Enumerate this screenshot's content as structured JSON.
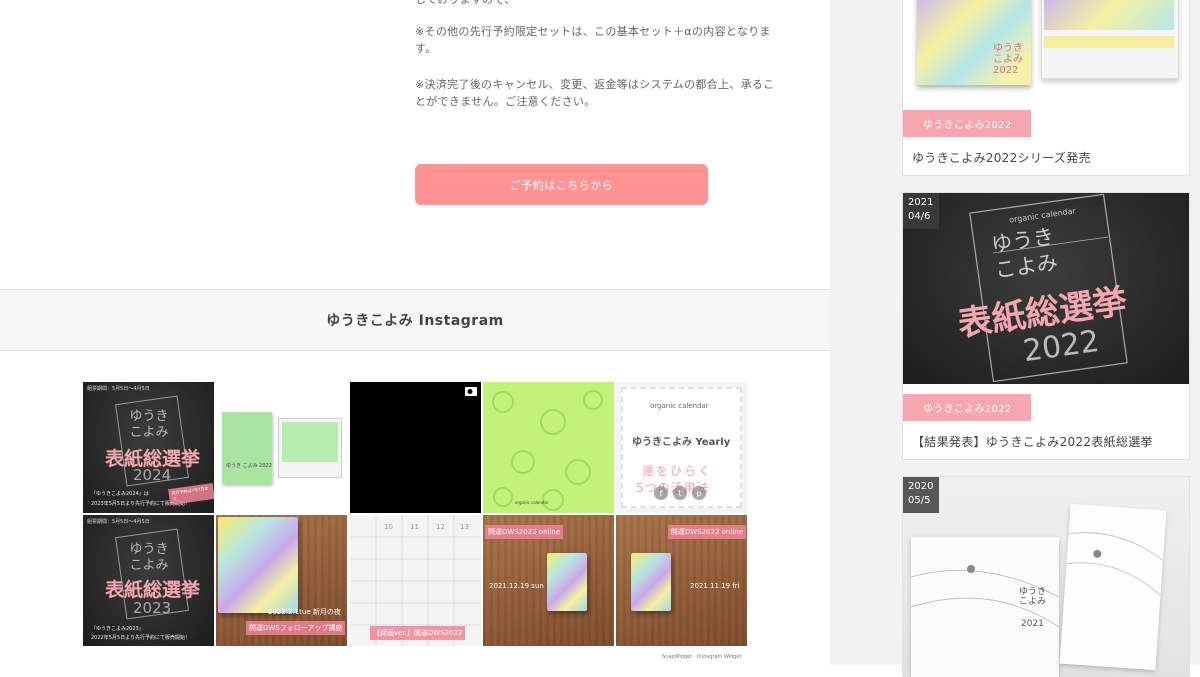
{
  "notes": {
    "partial": "しておりますので、",
    "set_note": "※その他の先行予約限定セットは、この基本セット＋αの内容となります。",
    "cancel_note": "※決済完了後のキャンセル、変更、返金等はシステムの都合上、承ることができません。ご注意ください。"
  },
  "cta": {
    "label": "ご予約はこちらから"
  },
  "instagram": {
    "heading": "ゆうきこよみ Instagram",
    "credit": "SnapWidget · Instagram Widget",
    "tiles": [
      {
        "top": "組票期間：5月5日〜4月5日",
        "title": "表紙総選挙",
        "year": "2024",
        "bottom": "2023年5月5日より先行予約にて販売開始！",
        "stamp": "先行予約は7月7日まで",
        "head": "『ゆうきこよみ2024』は"
      },
      {
        "caption": "ゆうき こよみ 2022"
      },
      {
        "video": "video-camera-icon"
      },
      {
        "caption": "organic calendar"
      },
      {
        "brand": "organic calendar",
        "title": "ゆうきこよみ Yearly",
        "line1": "運をひらく",
        "line2": "5つの活用法"
      },
      {
        "top": "組票期間：5月5日〜4月5日",
        "title": "表紙総選挙",
        "year": "2023",
        "bottom": "2022年5月5日より先行予約にて販売開始！",
        "head": "『ゆうきこよみ2023』"
      },
      {
        "date": "2022.2.1tue 新月の夜",
        "tag": "開運DWSフォローアップ講座"
      },
      {
        "tag": "【録画ver.】開運DWS2022"
      },
      {
        "tag": "開運DWS2022 online",
        "date": "2021.12.19 sun"
      },
      {
        "tag": "開運DWS2022 online",
        "date": "2021.11.19 fri"
      }
    ]
  },
  "sidebar": {
    "posts": [
      {
        "category": "ゆうきこよみ2022",
        "title": "ゆうきこよみ2022シリーズ発売",
        "img_text": "ゆうき こよみ 2022"
      },
      {
        "date_year": "2021",
        "date_md": "04/6",
        "category": "ゆうきこよみ2022",
        "title": "【結果発表】ゆうきこよみ2022表紙総選挙",
        "img_brand": "organic calendar",
        "img_name": "ゆうき こよみ",
        "img_main": "表紙総選挙",
        "img_year": "2022"
      },
      {
        "date_year": "2020",
        "date_md": "05/5",
        "img_name": "ゆうき こよみ",
        "img_year": "2021"
      }
    ]
  },
  "colors": {
    "accent": "#ff9393",
    "category": "#f6a6ae"
  }
}
